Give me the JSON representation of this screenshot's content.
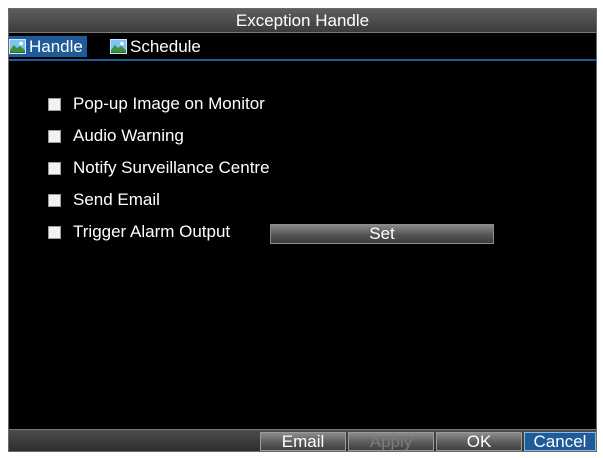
{
  "window": {
    "title": "Exception Handle"
  },
  "tabs": [
    {
      "label": "Handle",
      "icon": "landscape-icon",
      "active": true
    },
    {
      "label": "Schedule",
      "icon": "landscape-icon",
      "active": false
    }
  ],
  "options": [
    {
      "label": "Pop-up Image on Monitor",
      "checked": false
    },
    {
      "label": "Audio Warning",
      "checked": false
    },
    {
      "label": "Notify Surveillance Centre",
      "checked": false
    },
    {
      "label": "Send Email",
      "checked": false
    },
    {
      "label": "Trigger Alarm Output",
      "checked": false
    }
  ],
  "trigger_set_label": "Set",
  "footer": {
    "email_label": "Email",
    "apply_label": "Apply",
    "ok_label": "OK",
    "cancel_label": "Cancel"
  },
  "colors": {
    "accent": "#1f5a99",
    "background": "#000000",
    "text": "#ffffff",
    "disabled_text": "#7c7c7c"
  }
}
